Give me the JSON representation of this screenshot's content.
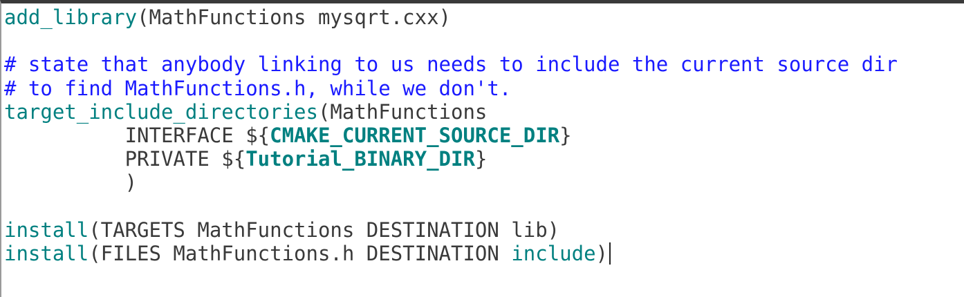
{
  "colors": {
    "command": "#008080",
    "comment": "#1a1aff",
    "variable": "#008080",
    "text": "#3a3a3a",
    "background": "#ffffff"
  },
  "lines": [
    {
      "cmd": "add_library",
      "rest": "(MathFunctions mysqrt.cxx)"
    },
    {
      "empty": ""
    },
    {
      "comment": "# state that anybody linking to us needs to include the current source dir"
    },
    {
      "comment": "# to find MathFunctions.h, while we don't."
    },
    {
      "cmd": "target_include_directories",
      "rest": "(MathFunctions"
    },
    {
      "pre": "          INTERFACE ${",
      "var": "CMAKE_CURRENT_SOURCE_DIR",
      "post": "}"
    },
    {
      "pre": "          PRIVATE ${",
      "var": "Tutorial_BINARY_DIR",
      "post": "}"
    },
    {
      "pre": "          )"
    },
    {
      "empty": ""
    },
    {
      "cmd": "install",
      "rest": "(TARGETS MathFunctions DESTINATION lib)"
    },
    {
      "cmd": "install",
      "rest": "(FILES MathFunctions.h DESTINATION ",
      "kw2": "include",
      "post": ")"
    }
  ]
}
